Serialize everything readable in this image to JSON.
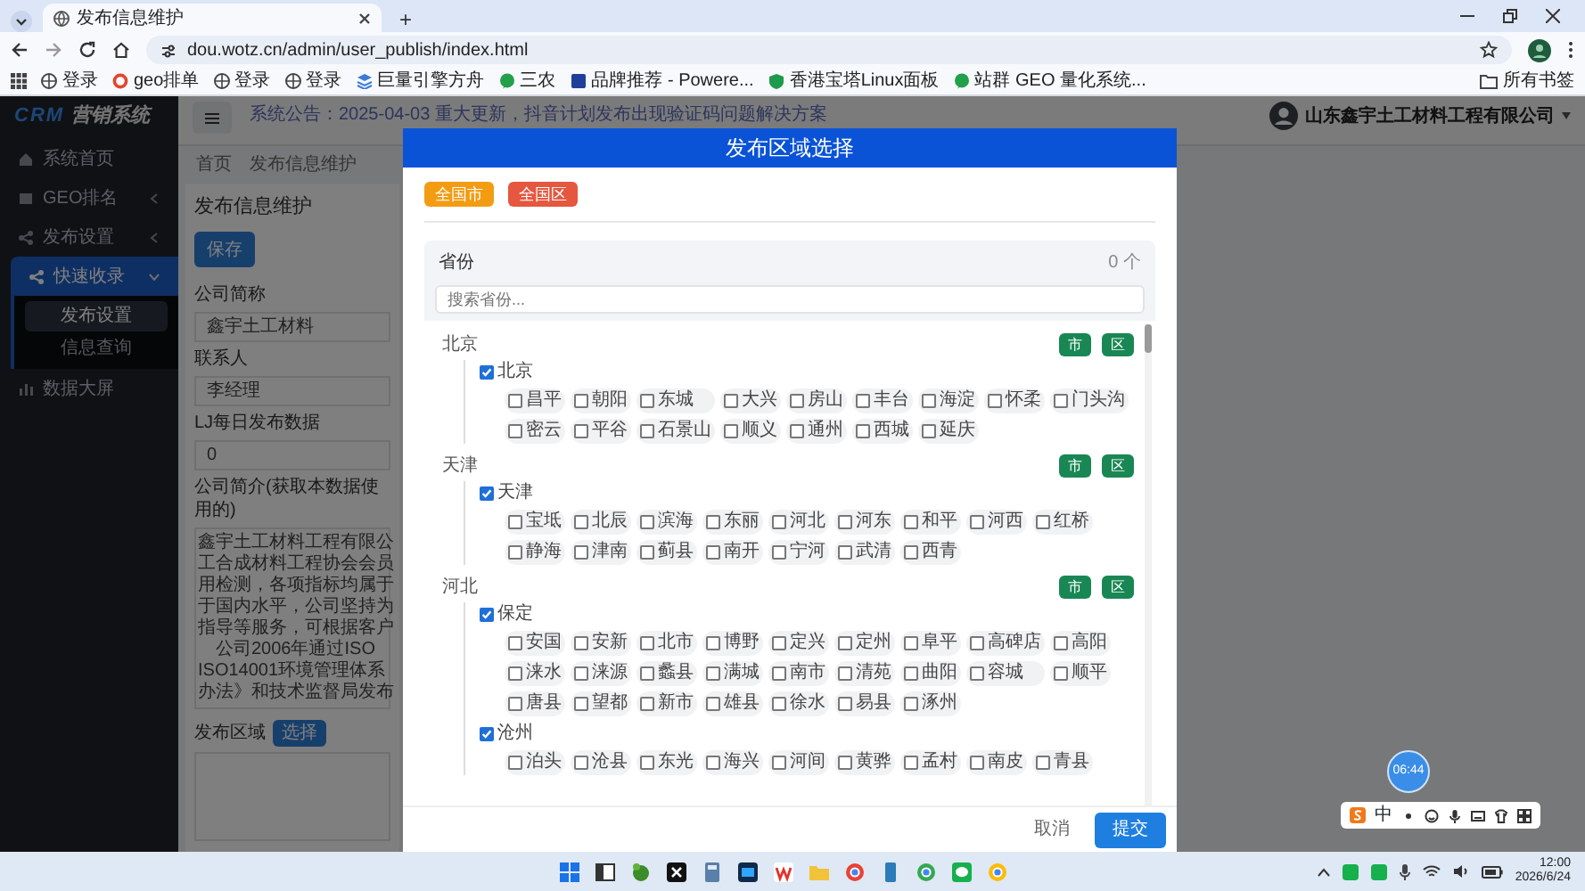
{
  "browser": {
    "tab_title": "发布信息维护",
    "new_tab": "+",
    "url": "dou.wotz.cn/admin/user_publish/index.html",
    "bookmarks": [
      "登录",
      "geo排单",
      "登录",
      "登录",
      "巨量引擎方舟",
      "三农",
      "品牌推荐 - Powere...",
      "香港宝塔Linux面板",
      "站群 GEO 量化系统..."
    ],
    "all_bookmarks": "所有书签"
  },
  "sidebar": {
    "logo_mark": "CRM",
    "logo_text": "营销系统",
    "items": [
      {
        "label": "系统首页",
        "selected": false
      },
      {
        "label": "GEO排名",
        "selected": false,
        "expanded": false
      },
      {
        "label": "发布设置",
        "selected": false,
        "expanded": false
      },
      {
        "label": "快速收录",
        "selected": true,
        "expanded": true,
        "children": [
          {
            "label": "发布设置",
            "selected": true
          },
          {
            "label": "信息查询",
            "selected": false
          }
        ]
      },
      {
        "label": "数据大屏",
        "selected": false
      }
    ]
  },
  "header": {
    "announcement": "系统公告：2025-04-03 重大更新，抖音计划发布出现验证码问题解决方案",
    "company": "山东鑫宇土工材料工程有限公司"
  },
  "breadcrumb": [
    "首页",
    "发布信息维护"
  ],
  "form": {
    "title": "发布信息维护",
    "save": "保存",
    "fields": [
      {
        "label": "公司简称",
        "value": "鑫宇土工材料"
      },
      {
        "label": "联系人",
        "value": "李经理"
      },
      {
        "label": "LJ每日发布数据",
        "value": "0"
      }
    ],
    "intro_label": "公司简介(获取本数据使用的)",
    "intro_lines": [
      "鑫宇土工材料工程有限公",
      "工合成材料工程协会会员",
      "用检测，各项指标均属于",
      "于国内水平，公司坚持为",
      "指导等服务，可根据客户",
      "　公司2006年通过ISO",
      "ISO14001环境管理体系",
      "办法》和技术监督局发布"
    ],
    "region_label": "发布区域",
    "choose": "选择"
  },
  "modal": {
    "title": "发布区域选择",
    "all_city": "全国市",
    "all_district": "全国区",
    "panel_title": "省份",
    "count": "0 个",
    "search_placeholder": "搜索省份...",
    "cancel": "取消",
    "submit": "提交",
    "provinces": [
      {
        "name": "北京",
        "city_button": "市",
        "district_button": "区",
        "cities": [
          {
            "name": "北京",
            "checked": true,
            "districts": [
              {
                "name": "昌平",
                "checked": false
              },
              {
                "name": "朝阳",
                "checked": false
              },
              {
                "name": "东城",
                "checked": false
              },
              {
                "name": "大兴",
                "checked": false
              },
              {
                "name": "房山",
                "checked": false
              },
              {
                "name": "丰台",
                "checked": false
              },
              {
                "name": "海淀",
                "checked": false
              },
              {
                "name": "怀柔",
                "checked": false
              },
              {
                "name": "门头沟",
                "checked": false
              },
              {
                "name": "密云",
                "checked": false
              },
              {
                "name": "平谷",
                "checked": false
              },
              {
                "name": "石景山",
                "checked": false
              },
              {
                "name": "顺义",
                "checked": false
              },
              {
                "name": "通州",
                "checked": false
              },
              {
                "name": "西城",
                "checked": false
              },
              {
                "name": "延庆",
                "checked": false
              }
            ]
          }
        ]
      },
      {
        "name": "天津",
        "city_button": "市",
        "district_button": "区",
        "cities": [
          {
            "name": "天津",
            "checked": true,
            "districts": [
              {
                "name": "宝坻",
                "checked": false
              },
              {
                "name": "北辰",
                "checked": false
              },
              {
                "name": "滨海",
                "checked": false
              },
              {
                "name": "东丽",
                "checked": false
              },
              {
                "name": "河北",
                "checked": false
              },
              {
                "name": "河东",
                "checked": false
              },
              {
                "name": "和平",
                "checked": false
              },
              {
                "name": "河西",
                "checked": false
              },
              {
                "name": "红桥",
                "checked": false
              },
              {
                "name": "静海",
                "checked": false
              },
              {
                "name": "津南",
                "checked": false
              },
              {
                "name": "蓟县",
                "checked": false
              },
              {
                "name": "南开",
                "checked": false
              },
              {
                "name": "宁河",
                "checked": false
              },
              {
                "name": "武清",
                "checked": false
              },
              {
                "name": "西青",
                "checked": false
              }
            ]
          }
        ]
      },
      {
        "name": "河北",
        "city_button": "市",
        "district_button": "区",
        "cities": [
          {
            "name": "保定",
            "checked": true,
            "districts": [
              {
                "name": "安国",
                "checked": false
              },
              {
                "name": "安新",
                "checked": false
              },
              {
                "name": "北市",
                "checked": false
              },
              {
                "name": "博野",
                "checked": false
              },
              {
                "name": "定兴",
                "checked": false
              },
              {
                "name": "定州",
                "checked": false
              },
              {
                "name": "阜平",
                "checked": false
              },
              {
                "name": "高碑店",
                "checked": false
              },
              {
                "name": "高阳",
                "checked": false
              },
              {
                "name": "涞水",
                "checked": false
              },
              {
                "name": "涞源",
                "checked": false
              },
              {
                "name": "蠡县",
                "checked": false
              },
              {
                "name": "满城",
                "checked": false
              },
              {
                "name": "南市",
                "checked": false
              },
              {
                "name": "清苑",
                "checked": false
              },
              {
                "name": "曲阳",
                "checked": false
              },
              {
                "name": "容城",
                "checked": false
              },
              {
                "name": "顺平",
                "checked": false
              },
              {
                "name": "唐县",
                "checked": false
              },
              {
                "name": "望都",
                "checked": false
              },
              {
                "name": "新市",
                "checked": false
              },
              {
                "name": "雄县",
                "checked": false
              },
              {
                "name": "徐水",
                "checked": false
              },
              {
                "name": "易县",
                "checked": false
              },
              {
                "name": "涿州",
                "checked": false
              }
            ]
          },
          {
            "name": "沧州",
            "checked": true,
            "districts": [
              {
                "name": "泊头",
                "checked": false
              },
              {
                "name": "沧县",
                "checked": false
              },
              {
                "name": "东光",
                "checked": false
              },
              {
                "name": "海兴",
                "checked": false
              },
              {
                "name": "河间",
                "checked": false
              },
              {
                "name": "黄骅",
                "checked": false
              },
              {
                "name": "孟村",
                "checked": false
              },
              {
                "name": "南皮",
                "checked": false
              },
              {
                "name": "青县",
                "checked": false
              }
            ]
          }
        ]
      }
    ]
  },
  "timer": "06:44",
  "ime_mode": "中",
  "taskbar": {
    "time": "12:00",
    "date": "2026/6/24"
  }
}
